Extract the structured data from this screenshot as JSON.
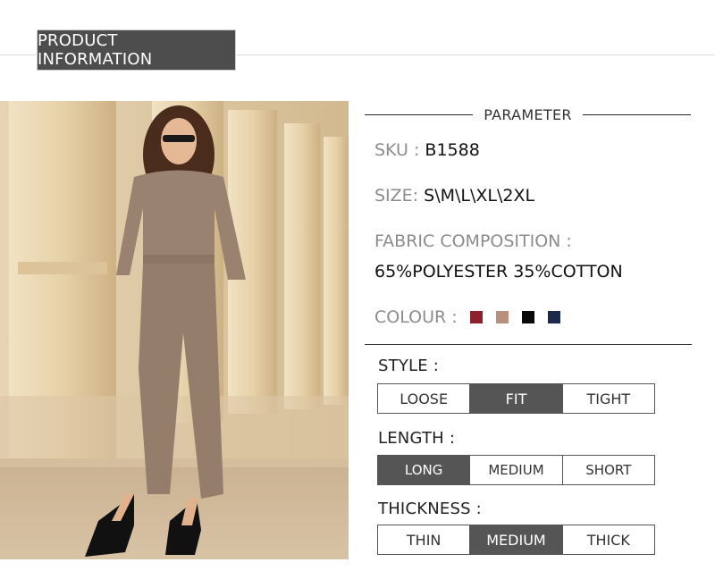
{
  "header": {
    "title": "PRODUCT  INFORMATION"
  },
  "parameter": {
    "title": "PARAMETER",
    "sku_label": "SKU :",
    "sku_value": "B1588",
    "size_label": "SIZE:",
    "size_value": "S\\M\\L\\XL\\2XL",
    "fabric_label": "FABRIC COMPOSITION :",
    "fabric_value": "65%POLYESTER 35%COTTON",
    "colour_label": "COLOUR :",
    "colours": [
      "#8e1f2c",
      "#b7917b",
      "#0a0a0a",
      "#1e2a4d"
    ]
  },
  "style": {
    "label": "STYLE :",
    "options": [
      "LOOSE",
      "FIT",
      "TIGHT"
    ],
    "selected": "FIT"
  },
  "length": {
    "label": "LENGTH :",
    "options": [
      "LONG",
      "MEDIUM",
      "SHORT"
    ],
    "selected": "LONG"
  },
  "thickness": {
    "label": "THICKNESS :",
    "options": [
      "THIN",
      "MEDIUM",
      "THICK"
    ],
    "selected": "MEDIUM"
  }
}
